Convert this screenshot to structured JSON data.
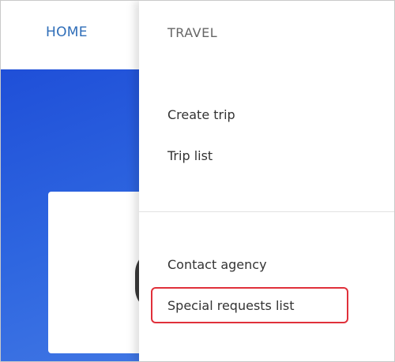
{
  "nav": {
    "home_label": "HOME"
  },
  "dropdown": {
    "header": "TRAVEL",
    "items": [
      {
        "label": "Create trip"
      },
      {
        "label": "Trip list"
      },
      {
        "label": "Contact agency"
      },
      {
        "label": "Special requests list"
      }
    ]
  },
  "colors": {
    "nav_link": "#2e6db8",
    "hero_blue": "#1f4fd8",
    "highlight_red": "#e0303a"
  }
}
